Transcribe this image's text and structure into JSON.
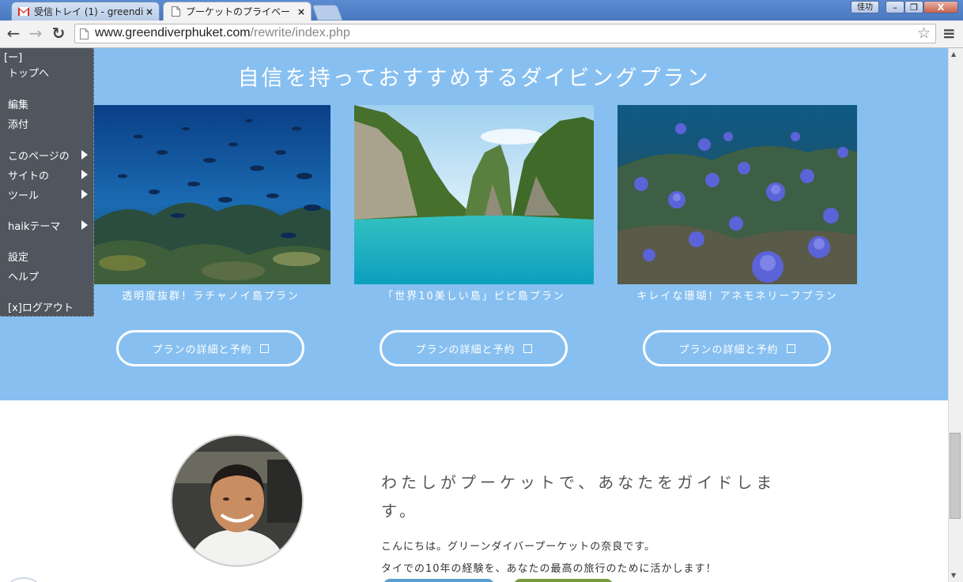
{
  "browser": {
    "tabs": [
      {
        "label": "受信トレイ (1) - greendi"
      },
      {
        "label": "プーケットのプライベー"
      }
    ],
    "close_glyph": "×",
    "window_buttons": {
      "user": "佳功",
      "minimize": "–",
      "restore": "❐",
      "close": "X"
    },
    "url_host": "www.greendiverphuket.com",
    "url_path": "/rewrite/index.php",
    "back_glyph": "←",
    "forward_glyph": "→",
    "reload_glyph": "↻",
    "star_glyph": "☆",
    "menu_glyph": "≡"
  },
  "admin_menu": {
    "collapse": "[ー]",
    "top": "トップへ",
    "edit": "編集",
    "attach": "添付",
    "this_page": "このページの",
    "site": "サイトの",
    "tools": "ツール",
    "haik_theme": "haikテーマ",
    "settings": "設定",
    "help": "ヘルプ",
    "logout": "[x]ログアウト"
  },
  "plans": {
    "heading": "自信を持っておすすめするダイビングプラン",
    "items": [
      {
        "caption": "透明度抜群！ラチャノイ島プラン",
        "button": "プランの詳細と予約"
      },
      {
        "caption": "「世界10美しい島」ピピ島プラン",
        "button": "プランの詳細と予約"
      },
      {
        "caption": "キレイな珊瑚！アネモネリーフプラン",
        "button": "プランの詳細と予約"
      }
    ]
  },
  "guide": {
    "title": "わたしがプーケットで、あなたをガイドします。",
    "line1": "こんにちは。グリーンダイバープーケットの奈良です。",
    "line2": "タイでの10年の経験を、あなたの最高の旅行のために活かします！"
  },
  "colors": {
    "section_blue": "#87c0f0",
    "menu_bg": "#50565e",
    "titlebar": "#4a78bf"
  }
}
